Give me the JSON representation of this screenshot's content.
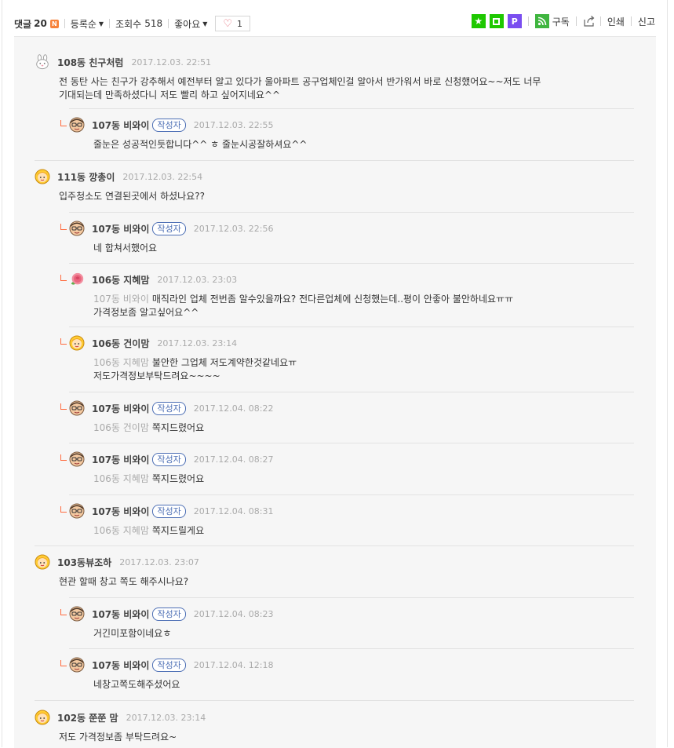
{
  "toolbar": {
    "comment_label": "댓글",
    "comment_count": "20",
    "new_badge": "N",
    "sort_label": "등록순",
    "views_label": "조회수",
    "views_count": "518",
    "like_dropdown": "좋아요",
    "like_count": "1",
    "subscribe_label": "구독",
    "print_label": "인쇄",
    "report_label": "신고",
    "bookmark_icon_char": "★",
    "plugin_icon_char": "P"
  },
  "comments": [
    {
      "nick": "108동 친구처럼",
      "date": "2017.12.03. 22:51",
      "avatar": "bunny",
      "author": false,
      "reply": false,
      "mention": "",
      "text": "전 동탄 사는 친구가 강추해서 예전부터 알고 있다가 울아파트 공구업체인걸 알아서 반가워서 바로 신청했어요~~저도 너무",
      "text2": "기대되는데 만족하셨다니 저도 빨리 하고 싶어지네요^^"
    },
    {
      "nick": "107동 비와이",
      "date": "2017.12.03. 22:55",
      "avatar": "face",
      "author": true,
      "author_label": "작성자",
      "reply": true,
      "mention": "",
      "text": "줄눈은 성공적인듯합니다^^ ㅎ 줄눈시공잘하셔요^^",
      "text2": ""
    },
    {
      "nick": "111동 깡총이",
      "date": "2017.12.03. 22:54",
      "avatar": "blonde",
      "author": false,
      "reply": false,
      "mention": "",
      "text": "입주청소도 연결된곳에서 하셨나요??",
      "text2": ""
    },
    {
      "nick": "107동 비와이",
      "date": "2017.12.03. 22:56",
      "avatar": "face",
      "author": true,
      "author_label": "작성자",
      "reply": true,
      "mention": "",
      "text": "네 합쳐서했어요",
      "text2": ""
    },
    {
      "nick": "106동 지혜맘",
      "date": "2017.12.03. 23:03",
      "avatar": "rose",
      "author": false,
      "reply": true,
      "mention": "107동 비와이",
      "text": "매직라인 업체 전번좀 알수있을까요? 전다른업체에 신청했는데..평이 안좋아 불안하네요ㅠㅠ",
      "text2": "가격정보좀 알고싶어요^^"
    },
    {
      "nick": "106동 건이맘",
      "date": "2017.12.03. 23:14",
      "avatar": "blonde",
      "author": false,
      "reply": true,
      "mention": "106동 지혜맘",
      "text": "불안한 그업체 저도계약한것같네요ㅠ",
      "text2": "저도가격정보부탁드려요~~~~"
    },
    {
      "nick": "107동 비와이",
      "date": "2017.12.04. 08:22",
      "avatar": "face",
      "author": true,
      "author_label": "작성자",
      "reply": true,
      "mention": "106동 건이맘",
      "text": "쪽지드렸어요",
      "text2": ""
    },
    {
      "nick": "107동 비와이",
      "date": "2017.12.04. 08:27",
      "avatar": "face",
      "author": true,
      "author_label": "작성자",
      "reply": true,
      "mention": "106동 지혜맘",
      "text": "쪽지드렸어요",
      "text2": ""
    },
    {
      "nick": "107동 비와이",
      "date": "2017.12.04. 08:31",
      "avatar": "face",
      "author": true,
      "author_label": "작성자",
      "reply": true,
      "mention": "106동 지혜맘",
      "text": "쪽지드릴게요",
      "text2": ""
    },
    {
      "nick": "103동뷰조하",
      "date": "2017.12.03. 23:07",
      "avatar": "blonde",
      "author": false,
      "reply": false,
      "mention": "",
      "text": "현관 할때 창고 쪽도 해주시나요?",
      "text2": ""
    },
    {
      "nick": "107동 비와이",
      "date": "2017.12.04. 08:23",
      "avatar": "face",
      "author": true,
      "author_label": "작성자",
      "reply": true,
      "mention": "",
      "text": "거긴미포함이네요ㅎ",
      "text2": ""
    },
    {
      "nick": "107동 비와이",
      "date": "2017.12.04. 12:18",
      "avatar": "face",
      "author": true,
      "author_label": "작성자",
      "reply": true,
      "mention": "",
      "text": "네창고쪽도해주셨어요",
      "text2": ""
    },
    {
      "nick": "102동 쭌쭌 맘",
      "date": "2017.12.03. 23:14",
      "avatar": "blonde",
      "author": false,
      "reply": false,
      "mention": "",
      "text": "저도 가격정보좀 부탁드려요~",
      "text2": ""
    }
  ]
}
